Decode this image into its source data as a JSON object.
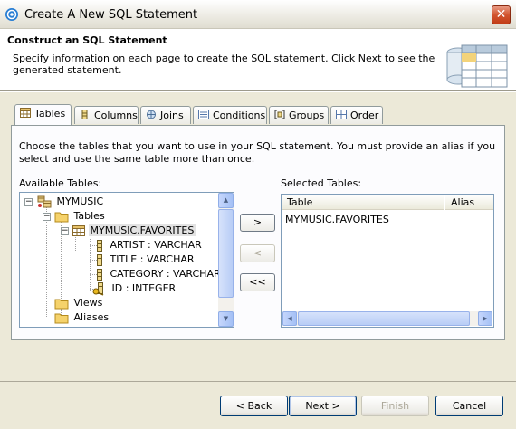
{
  "window": {
    "title": "Create A New SQL Statement"
  },
  "header": {
    "title": "Construct an SQL Statement",
    "description": "Specify information on each page to create the SQL statement. Click Next to see the generated statement."
  },
  "tabs": [
    {
      "label": "Tables",
      "icon": "table-icon",
      "active": true
    },
    {
      "label": "Columns",
      "icon": "columns-icon",
      "active": false
    },
    {
      "label": "Joins",
      "icon": "joins-icon",
      "active": false
    },
    {
      "label": "Conditions",
      "icon": "conditions-icon",
      "active": false
    },
    {
      "label": "Groups",
      "icon": "groups-icon",
      "active": false
    },
    {
      "label": "Order",
      "icon": "order-icon",
      "active": false
    }
  ],
  "instructions": "Choose the tables that you want to use in your SQL statement. You must provide an alias if you select and use the same table more than once.",
  "available_tables": {
    "label": "Available Tables:",
    "tree": [
      {
        "label": "MYMUSIC",
        "icon": "database-icon",
        "expand": "-"
      },
      {
        "label": "Tables",
        "icon": "folder-icon",
        "expand": "-"
      },
      {
        "label": "MYMUSIC.FAVORITES",
        "icon": "table-icon",
        "expand": "-",
        "selected": true
      },
      {
        "label": "ARTIST : VARCHAR",
        "icon": "column-icon"
      },
      {
        "label": "TITLE : VARCHAR",
        "icon": "column-icon"
      },
      {
        "label": "CATEGORY : VARCHAR",
        "icon": "column-icon"
      },
      {
        "label": "ID : INTEGER",
        "icon": "key-column-icon"
      },
      {
        "label": "Views",
        "icon": "folder-icon"
      },
      {
        "label": "Aliases",
        "icon": "folder-icon"
      }
    ]
  },
  "move_buttons": {
    "add": ">",
    "remove": "<",
    "remove_all": "<<"
  },
  "selected_tables": {
    "label": "Selected Tables:",
    "columns": [
      "Table",
      "Alias"
    ],
    "rows": [
      {
        "table": "MYMUSIC.FAVORITES",
        "alias": ""
      }
    ]
  },
  "wizard_buttons": {
    "back": "< Back",
    "next": "Next >",
    "finish": "Finish",
    "cancel": "Cancel"
  }
}
